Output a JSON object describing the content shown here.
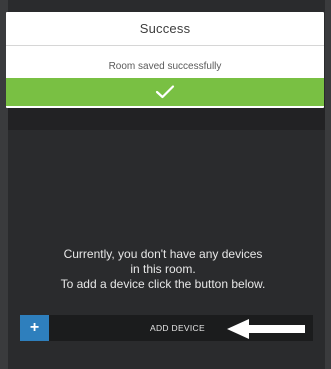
{
  "dialog": {
    "title": "Success",
    "message": "Room saved successfully"
  },
  "tabs": [
    "",
    "",
    ""
  ],
  "empty_state": {
    "line1": "Currently, you don't have any devices",
    "line2": "in this room.",
    "line3": "To add a device click the button below."
  },
  "add_device": {
    "plus": "+",
    "label": "ADD DEVICE"
  },
  "colors": {
    "success_green": "#79c043",
    "plus_blue": "#2e7fbd",
    "background": "#2a2b2d"
  },
  "icons": {
    "check": "check-icon",
    "arrow": "arrow-left-icon",
    "plus": "plus-icon"
  }
}
